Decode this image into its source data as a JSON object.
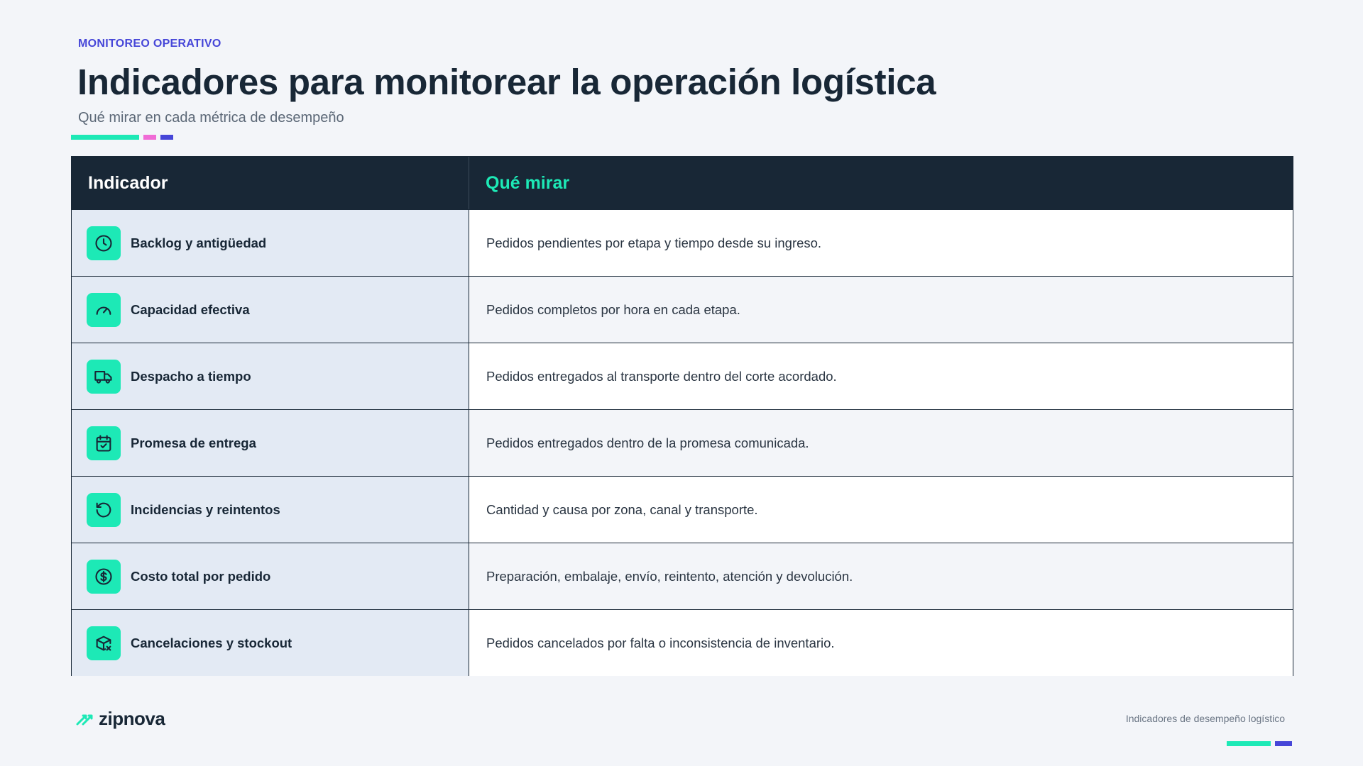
{
  "header": {
    "eyebrow": "MONITOREO OPERATIVO",
    "title": "Indicadores para monitorear la operación logística",
    "subtitle": "Qué mirar en cada métrica de desempeño"
  },
  "table": {
    "columns": [
      "Indicador",
      "Qué mirar"
    ],
    "rows": [
      {
        "indicator": "Backlog y antigüedad",
        "icon": "clock-icon",
        "description": "Pedidos pendientes por etapa y tiempo desde su ingreso."
      },
      {
        "indicator": "Capacidad efectiva",
        "icon": "gauge-icon",
        "description": "Pedidos completos por hora en cada etapa."
      },
      {
        "indicator": "Despacho a tiempo",
        "icon": "truck-icon",
        "description": "Pedidos entregados al transporte dentro del corte acordado."
      },
      {
        "indicator": "Promesa de entrega",
        "icon": "calendar-check-icon",
        "description": "Pedidos entregados dentro de la promesa comunicada."
      },
      {
        "indicator": "Incidencias y reintentos",
        "icon": "rotate-ccw-icon",
        "description": "Cantidad y causa por zona, canal y transporte."
      },
      {
        "indicator": "Costo total por pedido",
        "icon": "dollar-circle-icon",
        "description": "Preparación, embalaje, envío, reintento, atención y devolución."
      },
      {
        "indicator": "Cancelaciones y stockout",
        "icon": "package-x-icon",
        "description": "Pedidos cancelados por falta o inconsistencia de inventario."
      }
    ]
  },
  "footer": {
    "brand": "zipnova",
    "note": "Indicadores de desempeño logístico"
  },
  "colors": {
    "dark": "#182736",
    "mint": "#1de9b6",
    "pink": "#f06bd6",
    "indigo": "#4646d8",
    "label_blue": "#e3eaf4"
  }
}
